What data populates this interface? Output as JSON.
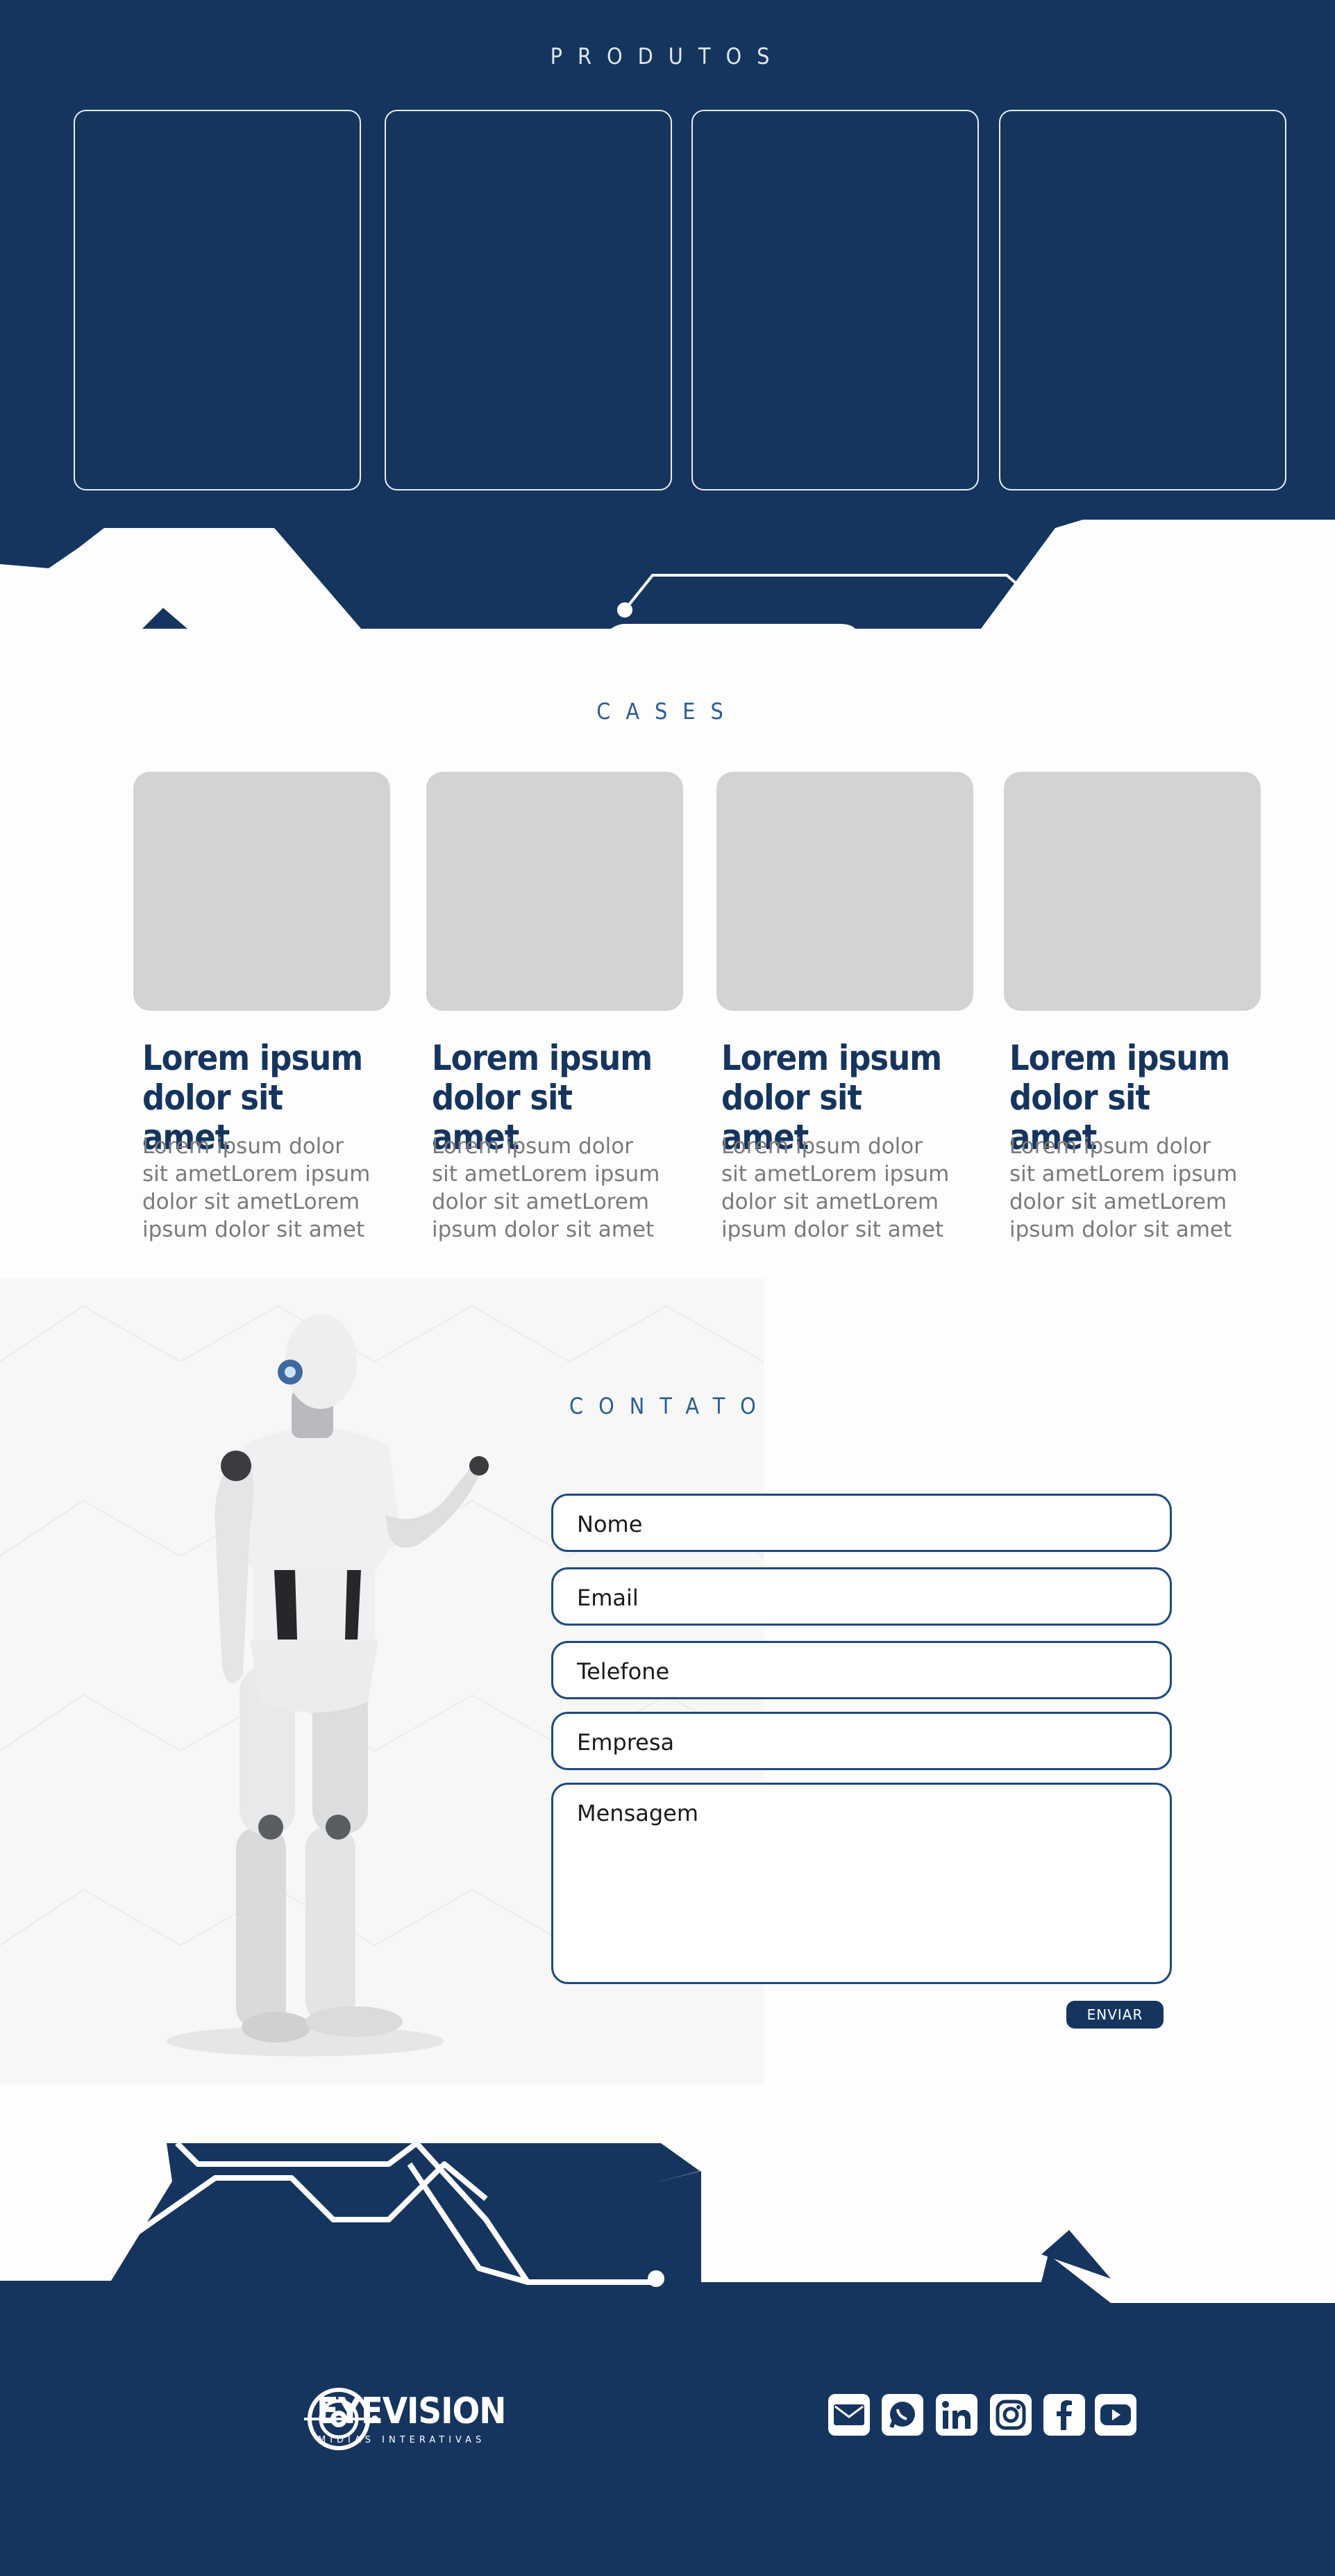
{
  "produtos": {
    "title": "PRODUTOS",
    "cards": 4
  },
  "cases": {
    "title": "CASES",
    "items": [
      {
        "heading_line1": "Lorem ipsum",
        "heading_line2": "dolor sit amet",
        "text": "Lorem ipsum dolor sit ametLorem ipsum dolor sit ametLorem ipsum dolor sit amet"
      },
      {
        "heading_line1": "Lorem ipsum",
        "heading_line2": "dolor sit amet",
        "text": "Lorem ipsum dolor sit ametLorem ipsum dolor sit ametLorem ipsum dolor sit amet"
      },
      {
        "heading_line1": "Lorem ipsum",
        "heading_line2": "dolor sit amet",
        "text": "Lorem ipsum dolor sit ametLorem ipsum dolor sit ametLorem ipsum dolor sit amet"
      },
      {
        "heading_line1": "Lorem ipsum",
        "heading_line2": "dolor sit amet",
        "text": "Lorem ipsum dolor sit ametLorem ipsum dolor sit ametLorem ipsum dolor sit amet"
      }
    ]
  },
  "contato": {
    "title": "CONTATO",
    "fields": {
      "nome": "Nome",
      "email": "Email",
      "telefone": "Telefone",
      "empresa": "Empresa",
      "mensagem": "Mensagem"
    },
    "send_label": "ENVIAR"
  },
  "footer": {
    "brand": "EYEVISION",
    "tagline": "MÍDIAS INTERATIVAS",
    "social_icons": [
      "email-icon",
      "whatsapp-icon",
      "linkedin-icon",
      "instagram-icon",
      "facebook-icon",
      "youtube-icon"
    ]
  },
  "colors": {
    "navy": "#15355f",
    "accent_blue": "#2a5d95",
    "card_gray": "#d2d3d5",
    "text_gray": "#7a7a7a"
  }
}
